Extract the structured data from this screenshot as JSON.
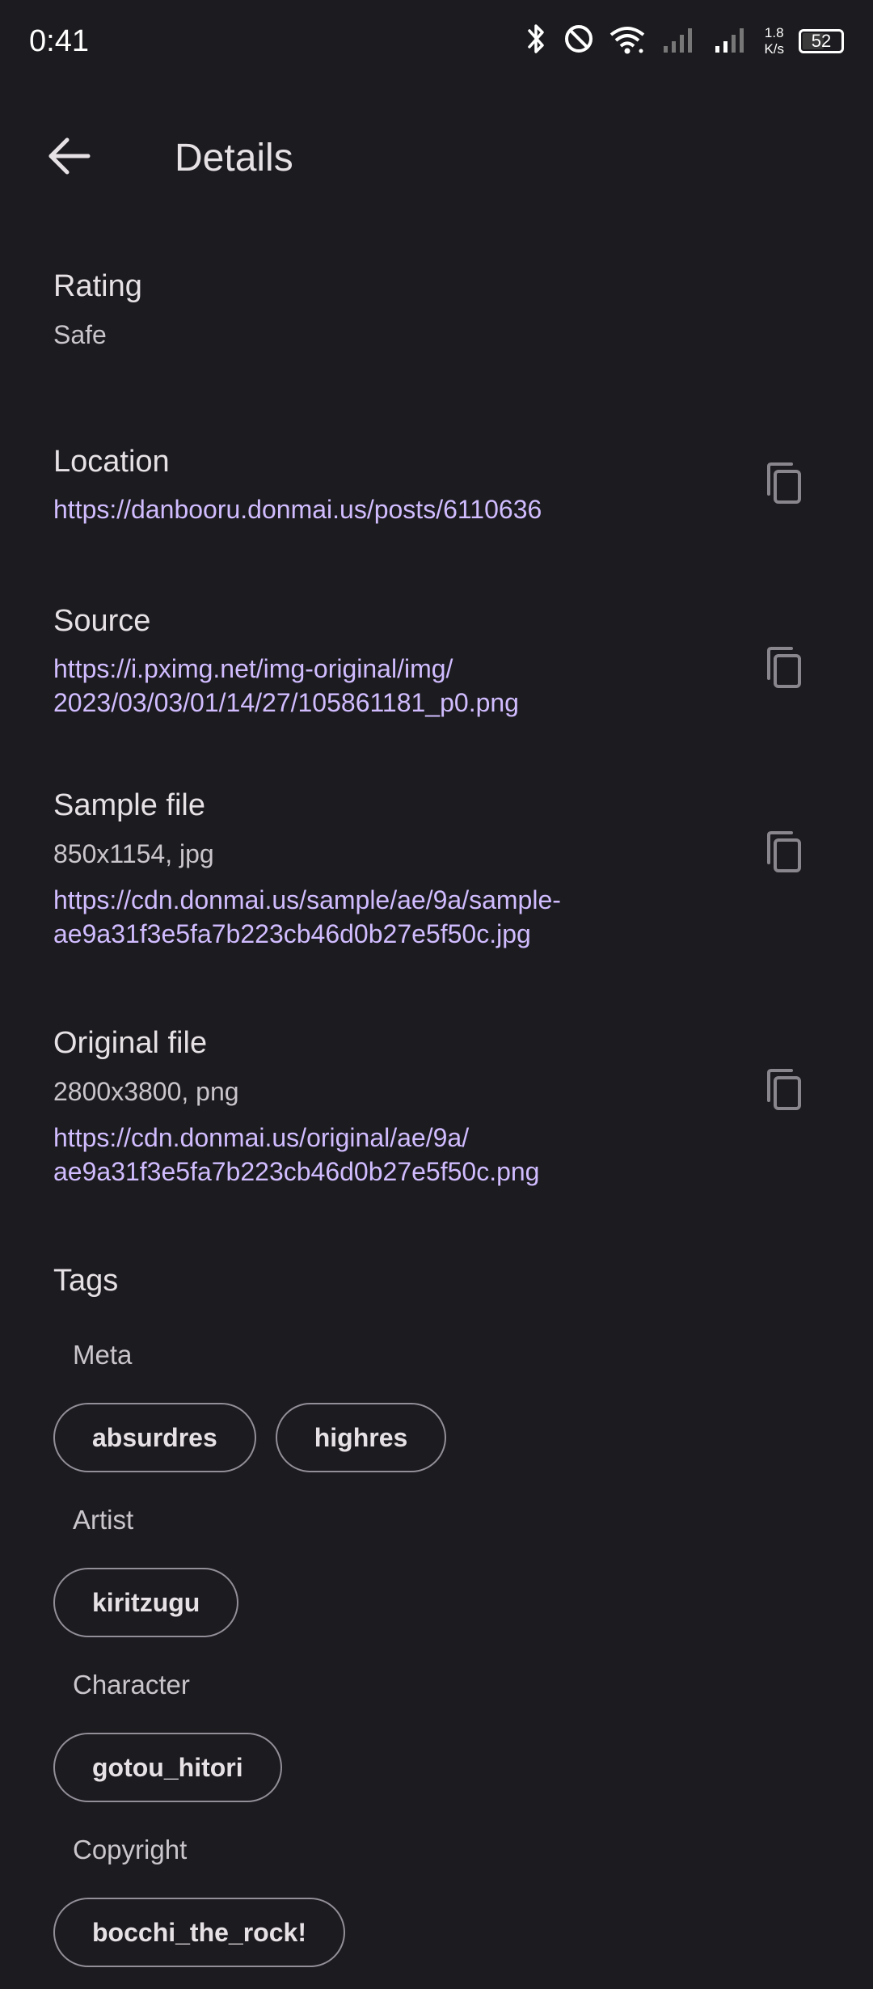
{
  "status_bar": {
    "time": "0:41",
    "net_speed_value": "1.8",
    "net_speed_unit": "K/s",
    "battery": "52",
    "icons": [
      "bluetooth-icon",
      "do-not-disturb-icon",
      "wifi-icon",
      "signal-icon",
      "signal-icon"
    ]
  },
  "app_bar": {
    "title": "Details",
    "back_icon": "arrow-left-icon"
  },
  "rating": {
    "title": "Rating",
    "value": "Safe"
  },
  "location": {
    "title": "Location",
    "url": "https://danbooru.donmai.us/posts/6110636",
    "copy_icon": "copy-icon"
  },
  "source": {
    "title": "Source",
    "url_line1": "https://i.pximg.net/img-original/img/",
    "url_line2": "2023/03/03/01/14/27/105861181_p0.png",
    "copy_icon": "copy-icon"
  },
  "sample_file": {
    "title": "Sample file",
    "info": "850x1154, jpg",
    "url_line1": "https://cdn.donmai.us/sample/ae/9a/sample-",
    "url_line2": "ae9a31f3e5fa7b223cb46d0b27e5f50c.jpg",
    "copy_icon": "copy-icon"
  },
  "original_file": {
    "title": "Original file",
    "info": "2800x3800, png",
    "url_line1": "https://cdn.donmai.us/original/ae/9a/",
    "url_line2": "ae9a31f3e5fa7b223cb46d0b27e5f50c.png",
    "copy_icon": "copy-icon"
  },
  "tags": {
    "title": "Tags",
    "groups": [
      {
        "label": "Meta",
        "chips": [
          "absurdres",
          "highres"
        ]
      },
      {
        "label": "Artist",
        "chips": [
          "kiritzugu"
        ]
      },
      {
        "label": "Character",
        "chips": [
          "gotou_hitori"
        ]
      },
      {
        "label": "Copyright",
        "chips": [
          "bocchi_the_rock!"
        ]
      }
    ]
  },
  "colors": {
    "background": "#1c1b1f",
    "link": "#d0bcff",
    "text": "#e6e1e5",
    "secondary_text": "#c9c5ca",
    "chip_border": "#938f99"
  }
}
